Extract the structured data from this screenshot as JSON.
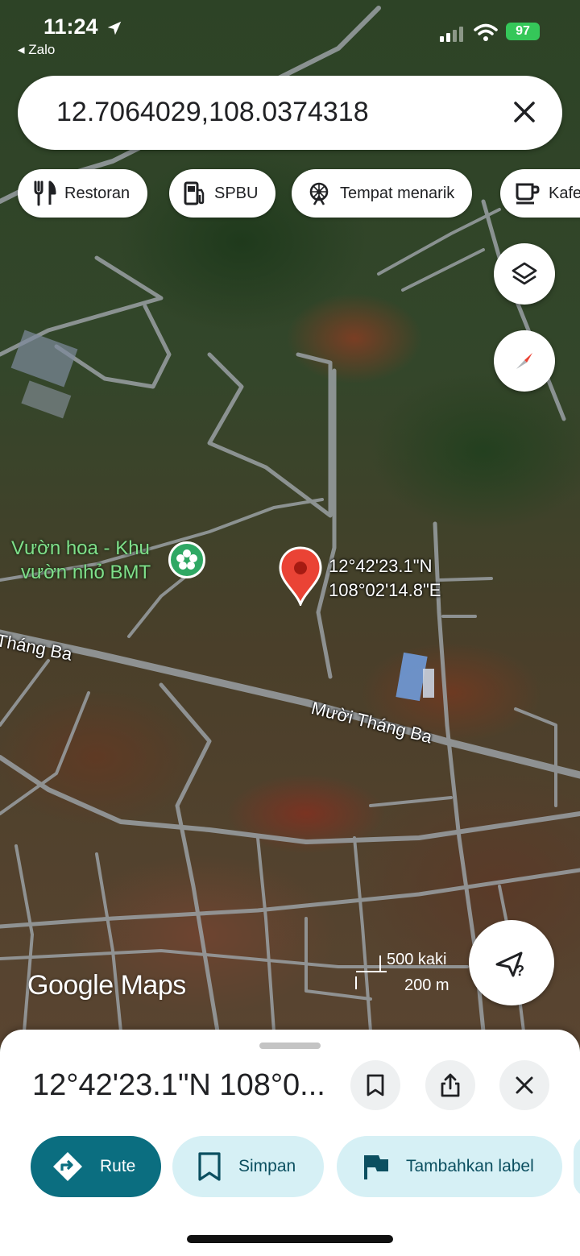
{
  "status_bar": {
    "time": "11:24",
    "back_app": "◂ Zalo",
    "battery": "97"
  },
  "search": {
    "query": "12.7064029,108.0374318"
  },
  "chips": [
    {
      "label": "Restoran",
      "icon": "fork-knife-icon"
    },
    {
      "label": "SPBU",
      "icon": "gas-station-icon"
    },
    {
      "label": "Tempat menarik",
      "icon": "ferris-wheel-icon"
    },
    {
      "label": "Kafe",
      "icon": "coffee-cup-icon"
    }
  ],
  "map": {
    "poi_name_line1": "Vườn hoa - Khu",
    "poi_name_line2": "vườn nhỏ BMT",
    "pin_lat": "12°42'23.1\"N",
    "pin_lng": "108°02'14.8\"E",
    "road_label_left": "Tháng Ba",
    "road_label_main": "Mười Tháng Ba",
    "attribution": "Google Maps",
    "scale_ft": "500 kaki",
    "scale_m": "200 m"
  },
  "sheet": {
    "title": "12°42'23.1\"N 108°0...",
    "actions": [
      {
        "label": "Rute",
        "icon": "directions-icon"
      },
      {
        "label": "Simpan",
        "icon": "bookmark-icon"
      },
      {
        "label": "Tambahkan label",
        "icon": "flag-icon"
      }
    ]
  },
  "colors": {
    "accent_primary": "#0b6e80",
    "accent_tint": "#d6f0f5",
    "pin_red": "#ea4335",
    "battery_green": "#35c759",
    "poi_green": "#2fa864"
  }
}
